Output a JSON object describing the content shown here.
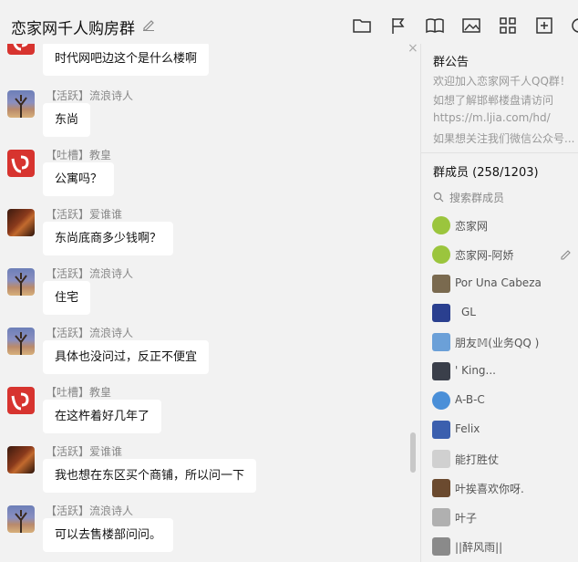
{
  "window": {
    "title": "恋家网千人购房群",
    "toolbar_icons": [
      "folder-icon",
      "flag-icon",
      "book-icon",
      "image-icon",
      "apps-icon",
      "add-icon",
      "gear-icon"
    ]
  },
  "chat": {
    "messages": [
      {
        "role": "",
        "name": "",
        "text": "时代网吧边这个是什么楼啊",
        "avatar": "logo"
      },
      {
        "role": "【活跃】",
        "name": "流浪诗人",
        "text": "东尚",
        "avatar": "tree"
      },
      {
        "role": "【吐槽】",
        "name": "教皇",
        "text": "公寓吗？",
        "avatar": "logo"
      },
      {
        "role": "【活跃】",
        "name": "爱谁谁",
        "text": "东尚底商多少钱啊？",
        "avatar": "violin"
      },
      {
        "role": "【活跃】",
        "name": "流浪诗人",
        "text": "住宅",
        "avatar": "tree"
      },
      {
        "role": "【活跃】",
        "name": "流浪诗人",
        "text": "具体也没问过，反正不便宜",
        "avatar": "tree"
      },
      {
        "role": "【吐槽】",
        "name": "教皇",
        "text": "在这杵着好几年了",
        "avatar": "logo"
      },
      {
        "role": "【活跃】",
        "name": "爱谁谁",
        "text": "我也想在东区买个商铺，所以问一下",
        "avatar": "violin"
      },
      {
        "role": "【活跃】",
        "name": "流浪诗人",
        "text": "可以去售楼部问问。",
        "avatar": "tree"
      }
    ]
  },
  "sidebar": {
    "notice_title": "群公告",
    "notice_lines": [
      "欢迎加入恋家网千人QQ群！",
      "如想了解邯郸楼盘请访问",
      "https://m.ljia.com/hd/",
      "如果想关注我们微信公众号..."
    ],
    "members_title": "群成员 (258/1203)",
    "search_placeholder": "搜索群成员",
    "members": [
      {
        "name": "恋家网",
        "color": "#9bc53d"
      },
      {
        "name": "恋家网-阿娇",
        "color": "#9bc53d"
      },
      {
        "name": "Por Una Cabeza",
        "color": "#7a6a4f"
      },
      {
        "name": "GL",
        "color": "#2a3f8f"
      },
      {
        "name": "朋友𝕄(业务QQ )",
        "color": "#6ba0d8"
      },
      {
        "name": "' King...",
        "color": "#3a3f4a"
      },
      {
        "name": "A-B-C",
        "color": "#4a8fd8"
      },
      {
        "name": "Felix",
        "color": "#3b5fae"
      },
      {
        "name": "能打胜仗",
        "color": "#d0d0d0"
      },
      {
        "name": "叶挨喜欢你呀.",
        "color": "#6b4a2f"
      },
      {
        "name": "叶子",
        "color": "#b0b0b0"
      },
      {
        "name": "||醉风雨||",
        "color": "#8a8a8a"
      }
    ]
  }
}
